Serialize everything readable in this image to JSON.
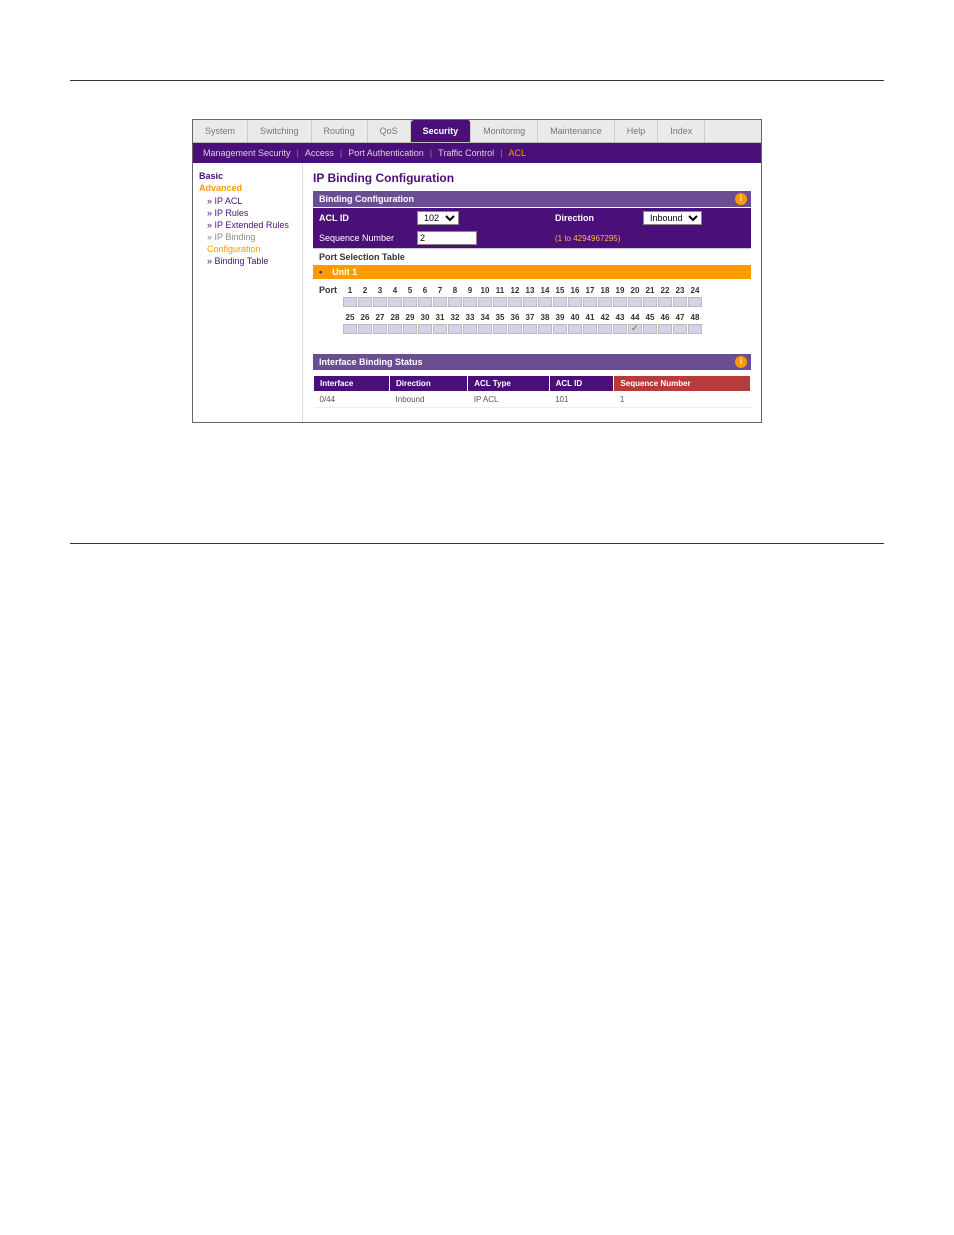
{
  "topnav": {
    "items": [
      "System",
      "Switching",
      "Routing",
      "QoS",
      "Security",
      "Monitoring",
      "Maintenance",
      "Help",
      "Index"
    ],
    "active_index": 4
  },
  "subnav": {
    "items": [
      "Management Security",
      "Access",
      "Port Authentication",
      "Traffic Control",
      "ACL"
    ],
    "active_index": 4
  },
  "sidebar": {
    "group1": "Basic",
    "group2": "Advanced",
    "items": [
      {
        "label": "IP ACL",
        "prefix": "»",
        "state": "normal"
      },
      {
        "label": "IP Rules",
        "prefix": "»",
        "state": "normal"
      },
      {
        "label": "IP Extended Rules",
        "prefix": "»",
        "state": "normal"
      },
      {
        "label": "IP Binding",
        "prefix": "»",
        "state": "dim"
      },
      {
        "label": "Configuration",
        "prefix": "",
        "state": "sel"
      },
      {
        "label": "Binding Table",
        "prefix": "»",
        "state": "normal"
      }
    ]
  },
  "page": {
    "title": "IP Binding Configuration"
  },
  "binding_config": {
    "panel_title": "Binding Configuration",
    "acl_id_label": "ACL ID",
    "acl_id_value": "102",
    "direction_label": "Direction",
    "direction_value": "Inbound",
    "seq_label": "Sequence Number",
    "seq_value": "2",
    "seq_hint": "(1 to 4294967295)"
  },
  "port_selection": {
    "title": "Port Selection Table",
    "unit_label": "Unit 1",
    "row_label": "Port",
    "row1": [
      "1",
      "2",
      "3",
      "4",
      "5",
      "6",
      "7",
      "8",
      "9",
      "10",
      "11",
      "12",
      "13",
      "14",
      "15",
      "16",
      "17",
      "18",
      "19",
      "20",
      "21",
      "22",
      "23",
      "24"
    ],
    "row2": [
      "25",
      "26",
      "27",
      "28",
      "29",
      "30",
      "31",
      "32",
      "33",
      "34",
      "35",
      "36",
      "37",
      "38",
      "39",
      "40",
      "41",
      "42",
      "43",
      "44",
      "45",
      "46",
      "47",
      "48"
    ],
    "selected_port_row2_index": 19
  },
  "status": {
    "panel_title": "Interface Binding Status",
    "cols": [
      "Interface",
      "Direction",
      "ACL Type",
      "ACL ID",
      "Sequence Number"
    ],
    "rows": [
      {
        "interface": "0/44",
        "direction": "Inbound",
        "acl_type": "IP ACL",
        "acl_id": "101",
        "seq": "1"
      }
    ]
  }
}
